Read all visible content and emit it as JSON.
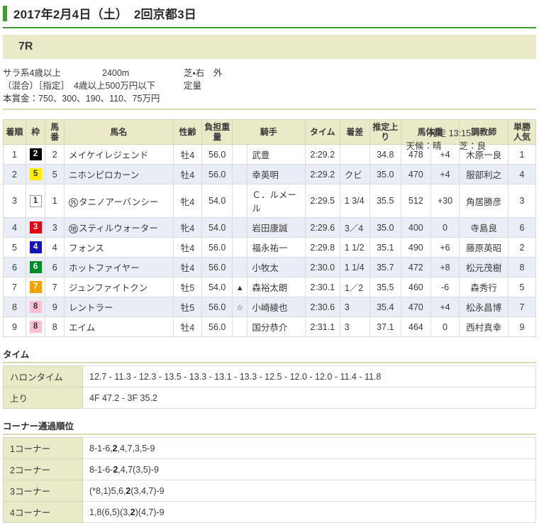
{
  "header": {
    "date_title": "2017年2月4日（土）　2回京都3日",
    "accent_color": "#3f9b30"
  },
  "race": {
    "number_label": "7R",
    "banner_color": "#eaeac9",
    "conditions": {
      "class": "サラ系4歳以上",
      "distance": "2400m",
      "surface": "芝・右　外",
      "restriction": "（混合）［指定］　4歳以上500万円以下",
      "weight_rule": "定量",
      "prize": "本賞金：750、300、190、110、75万円",
      "start_time": "発走 13:15",
      "weather_track": "天候：晴　　芝：良"
    }
  },
  "results": {
    "columns": {
      "rank": "着順",
      "frame": "枠",
      "horse_number": "馬番",
      "horse_name": "馬名",
      "sex_age": "性齢",
      "carried_weight": "負担重量",
      "jockey": "騎手",
      "time": "タイム",
      "margin": "着差",
      "last_3f": "推定上り",
      "horse_weight": "馬体重",
      "trainer": "調教師",
      "popularity": "単勝人気"
    },
    "rows": [
      {
        "rank": "1",
        "frame": "2",
        "frame_class": "fr-2",
        "horse_number": "2",
        "tag": "",
        "horse_name": "メイケイレジェンド",
        "sex_age": "牡4",
        "carried_weight": "56.0",
        "jockey_mark": "",
        "jockey": "武豊",
        "time": "2:29.2",
        "margin": "",
        "last_3f": "34.8",
        "horse_weight": "478",
        "weight_diff": "+4",
        "trainer": "木原一良",
        "popularity": "1"
      },
      {
        "rank": "2",
        "frame": "5",
        "frame_class": "fr-5",
        "horse_number": "5",
        "tag": "",
        "horse_name": "ニホンピロカーン",
        "sex_age": "牡4",
        "carried_weight": "56.0",
        "jockey_mark": "",
        "jockey": "幸英明",
        "time": "2:29.2",
        "margin": "クビ",
        "last_3f": "35.0",
        "horse_weight": "470",
        "weight_diff": "+4",
        "trainer": "服部利之",
        "popularity": "4"
      },
      {
        "rank": "3",
        "frame": "1",
        "frame_class": "fr-1",
        "horse_number": "1",
        "tag": "外",
        "horse_name": "タニノアーバンシー",
        "sex_age": "牝4",
        "carried_weight": "54.0",
        "jockey_mark": "",
        "jockey": "Ｃ．ルメール",
        "time": "2:29.5",
        "margin": "1 3/4",
        "last_3f": "35.5",
        "horse_weight": "512",
        "weight_diff": "+30",
        "trainer": "角居勝彦",
        "popularity": "3"
      },
      {
        "rank": "4",
        "frame": "3",
        "frame_class": "fr-3",
        "horse_number": "3",
        "tag": "地",
        "horse_name": "スティルウォーター",
        "sex_age": "牝4",
        "carried_weight": "54.0",
        "jockey_mark": "",
        "jockey": "岩田康誠",
        "time": "2:29.6",
        "margin": "3／4",
        "last_3f": "35.0",
        "horse_weight": "400",
        "weight_diff": "0",
        "trainer": "寺島良",
        "popularity": "6"
      },
      {
        "rank": "5",
        "frame": "4",
        "frame_class": "fr-4",
        "horse_number": "4",
        "tag": "",
        "horse_name": "フォンス",
        "sex_age": "牡4",
        "carried_weight": "56.0",
        "jockey_mark": "",
        "jockey": "福永祐一",
        "time": "2:29.8",
        "margin": "1 1/2",
        "last_3f": "35.1",
        "horse_weight": "490",
        "weight_diff": "+6",
        "trainer": "藤原英昭",
        "popularity": "2"
      },
      {
        "rank": "6",
        "frame": "6",
        "frame_class": "fr-6",
        "horse_number": "6",
        "tag": "",
        "horse_name": "ホットファイヤー",
        "sex_age": "牡4",
        "carried_weight": "56.0",
        "jockey_mark": "",
        "jockey": "小牧太",
        "time": "2:30.0",
        "margin": "1 1/4",
        "last_3f": "35.7",
        "horse_weight": "472",
        "weight_diff": "+8",
        "trainer": "松元茂樹",
        "popularity": "8"
      },
      {
        "rank": "7",
        "frame": "7",
        "frame_class": "fr-7",
        "horse_number": "7",
        "tag": "",
        "horse_name": "ジュンファイトクン",
        "sex_age": "牡5",
        "carried_weight": "54.0",
        "jockey_mark": "▲",
        "jockey": "森裕太朗",
        "time": "2:30.1",
        "margin": "1／2",
        "last_3f": "35.5",
        "horse_weight": "460",
        "weight_diff": "-6",
        "trainer": "森秀行",
        "popularity": "5"
      },
      {
        "rank": "8",
        "frame": "8",
        "frame_class": "fr-8",
        "horse_number": "9",
        "tag": "",
        "horse_name": "レントラー",
        "sex_age": "牡5",
        "carried_weight": "56.0",
        "jockey_mark": "☆",
        "jockey": "小崎綾也",
        "time": "2:30.6",
        "margin": "3",
        "last_3f": "35.4",
        "horse_weight": "470",
        "weight_diff": "+4",
        "trainer": "松永昌博",
        "popularity": "7"
      },
      {
        "rank": "9",
        "frame": "8",
        "frame_class": "fr-8",
        "horse_number": "8",
        "tag": "",
        "horse_name": "エイム",
        "sex_age": "牡4",
        "carried_weight": "56.0",
        "jockey_mark": "",
        "jockey": "国分恭介",
        "time": "2:31.1",
        "margin": "3",
        "last_3f": "37.1",
        "horse_weight": "464",
        "weight_diff": "0",
        "trainer": "西村真幸",
        "popularity": "9"
      }
    ]
  },
  "time_section": {
    "title": "タイム",
    "rows": [
      {
        "label": "ハロンタイム",
        "value": "12.7 - 11.3 - 12.3 - 13.5 - 13.3 - 13.1 - 13.3 - 12.5 - 12.0 - 12.0 - 11.4 - 11.8"
      },
      {
        "label": "上り",
        "value": "4F 47.2 - 3F 35.2"
      }
    ]
  },
  "corner_section": {
    "title": "コーナー通過順位",
    "rows": [
      {
        "label": "1コーナー",
        "pre": "8-1-6,",
        "bold": "2",
        "post": ",4,7,3,5-9"
      },
      {
        "label": "2コーナー",
        "pre": "8-1-6-",
        "bold": "2",
        "post": ",4,7(3,5)-9"
      },
      {
        "label": "3コーナー",
        "pre": "(*8,1)5,6,",
        "bold": "2",
        "post": "(3,4,7)-9"
      },
      {
        "label": "4コーナー",
        "pre": "1,8(6,5)(3,",
        "bold": "2",
        "post": ")(4,7)-9"
      }
    ]
  }
}
